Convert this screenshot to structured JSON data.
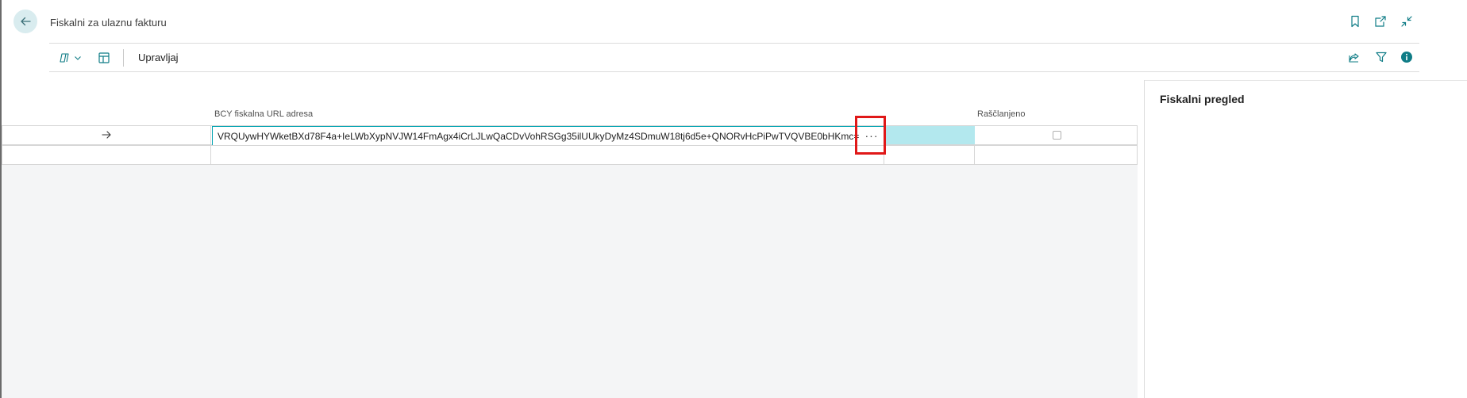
{
  "header": {
    "title": "Fiskalni za ulaznu fakturu"
  },
  "action_bar": {
    "manage_label": "Upravljaj"
  },
  "list": {
    "columns": {
      "url": "BCY fiskalna URL adresa",
      "parsed": "Raščlanjeno"
    },
    "rows": [
      {
        "url": "VRQUywHYWketBXd78F4a+IeLWbXypNVJW14FmAgx4iCrLJLwQaCDvVohRSGg35ilUUkyDyMz4SDmuW18tj6d5e+QNORvHcPiPwTVQVBE0bHKmc=",
        "parsed": false
      },
      {
        "url": "",
        "parsed": false
      }
    ]
  },
  "factbox": {
    "title": "Fiskalni pregled"
  },
  "colors": {
    "accent": "#00a3b1",
    "selected_cell": "#b3e8ee",
    "highlight": "#e01818",
    "info": "#0f7c86"
  }
}
